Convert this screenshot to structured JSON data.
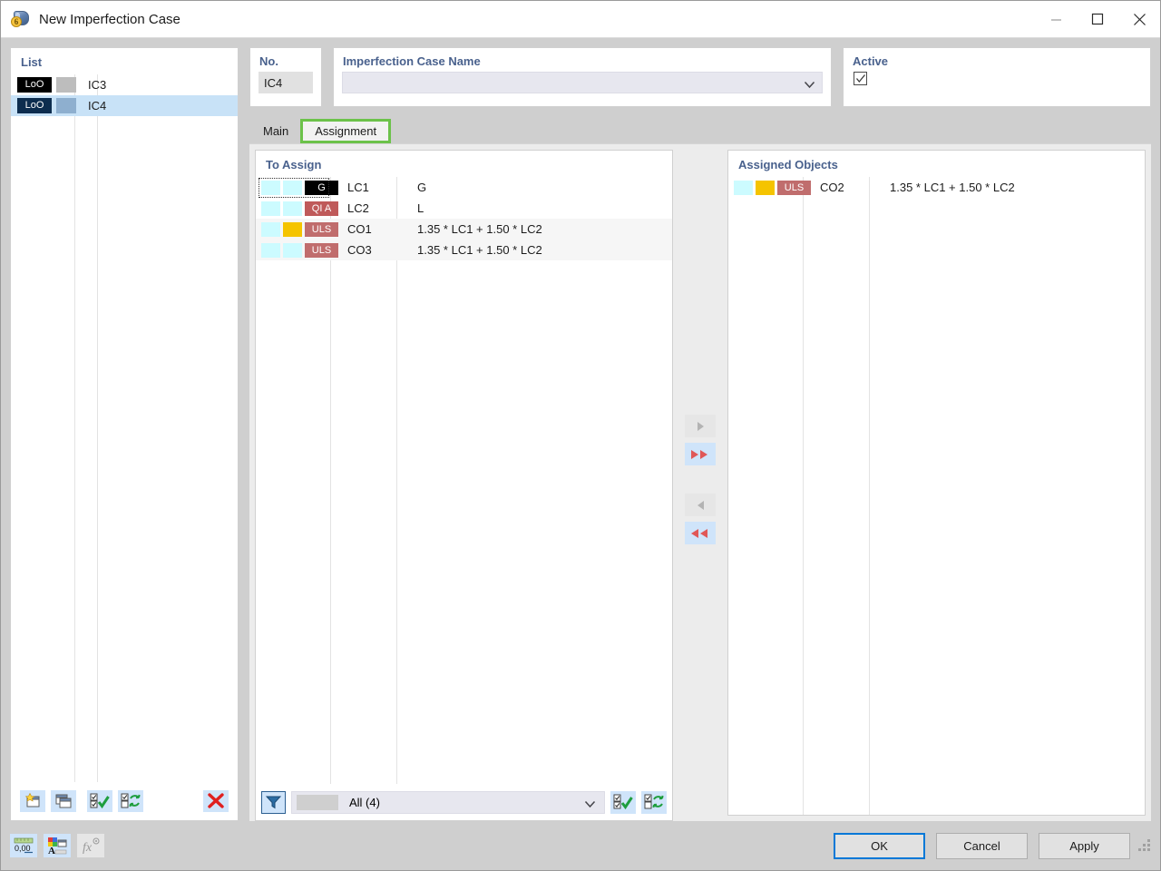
{
  "window": {
    "title": "New Imperfection Case",
    "icon": "imperfection-case-icon",
    "minimize": "—",
    "maximize": "□",
    "close": "✕"
  },
  "left": {
    "legend": "List",
    "rows": [
      {
        "badge": "LoO",
        "badge_bg": "#000000",
        "swatch": "#bdbdbd",
        "name": "IC3",
        "selected": false
      },
      {
        "badge": "LoO",
        "badge_bg": "#0d2d4f",
        "swatch": "#8eafcf",
        "name": "IC4",
        "selected": true
      }
    ],
    "toolbar": [
      {
        "name": "new-case-button",
        "label": "New"
      },
      {
        "name": "copy-case-button",
        "label": "Copy"
      },
      {
        "name": "select-all-button",
        "label": "Select All"
      },
      {
        "name": "invert-selection-button",
        "label": "Invert Selection"
      },
      {
        "name": "delete-case-button",
        "label": "Delete"
      }
    ]
  },
  "fields": {
    "no_label": "No.",
    "no_value": "IC4",
    "name_label": "Imperfection Case Name",
    "name_value": "",
    "name_placeholder": "",
    "active_label": "Active",
    "active_checked": true
  },
  "tabs": [
    {
      "label": "Main",
      "active": false
    },
    {
      "label": "Assignment",
      "active": true
    }
  ],
  "assignment": {
    "to_assign_label": "To Assign",
    "assigned_label": "Assigned Objects",
    "to_assign_rows": [
      {
        "sw1": "#ccfbff",
        "sw2": "#ccfbff",
        "badge": "G",
        "badge_bg": "#000000",
        "name": "LC1",
        "desc": "G",
        "focused": true,
        "alt": false
      },
      {
        "sw1": "#ccfbff",
        "sw2": "#ccfbff",
        "badge": "QI A",
        "badge_bg": "#bf5a5a",
        "name": "LC2",
        "desc": "L",
        "focused": false,
        "alt": false
      },
      {
        "sw1": "#ccfbff",
        "sw2": "#f5c400",
        "badge": "ULS",
        "badge_bg": "#c06d6d",
        "name": "CO1",
        "desc": "1.35 * LC1 + 1.50 * LC2",
        "focused": false,
        "alt": true
      },
      {
        "sw1": "#ccfbff",
        "sw2": "#ccfbff",
        "badge": "ULS",
        "badge_bg": "#c06d6d",
        "name": "CO3",
        "desc": "1.35 * LC1 + 1.50 * LC2",
        "focused": false,
        "alt": true
      }
    ],
    "assigned_rows": [
      {
        "sw1": "#ccfbff",
        "sw2": "#f5c400",
        "badge": "ULS",
        "badge_bg": "#c06d6d",
        "name": "CO2",
        "desc": "1.35 * LC1 + 1.50 * LC2"
      }
    ],
    "transfer_buttons": [
      {
        "name": "assign-selected-button",
        "glyph": "▶",
        "enabled": false
      },
      {
        "name": "assign-all-button",
        "glyph": "▶▶",
        "enabled": true
      },
      {
        "name": "unassign-selected-button",
        "glyph": "◀",
        "enabled": false
      },
      {
        "name": "unassign-all-button",
        "glyph": "◀◀",
        "enabled": true
      }
    ],
    "filter": {
      "button_name": "filter-button",
      "value": "All (4)",
      "select_all_name": "select-all-rows-button",
      "invert_name": "invert-rows-selection-button"
    }
  },
  "statusbar": {
    "buttons": [
      {
        "name": "number-format-button",
        "label": "0,00",
        "disabled": false
      },
      {
        "name": "font-color-button",
        "label": "A",
        "disabled": false
      },
      {
        "name": "formula-button",
        "label": "fx",
        "disabled": true
      }
    ]
  },
  "dialog_buttons": {
    "ok": "OK",
    "cancel": "Cancel",
    "apply": "Apply"
  },
  "colors": {
    "legend_text": "#49618d",
    "tab_highlight": "#6cc24a",
    "default_button_border": "#0078d7",
    "selection_blue": "#c8e2f7",
    "transfer_red": "#e05757"
  }
}
